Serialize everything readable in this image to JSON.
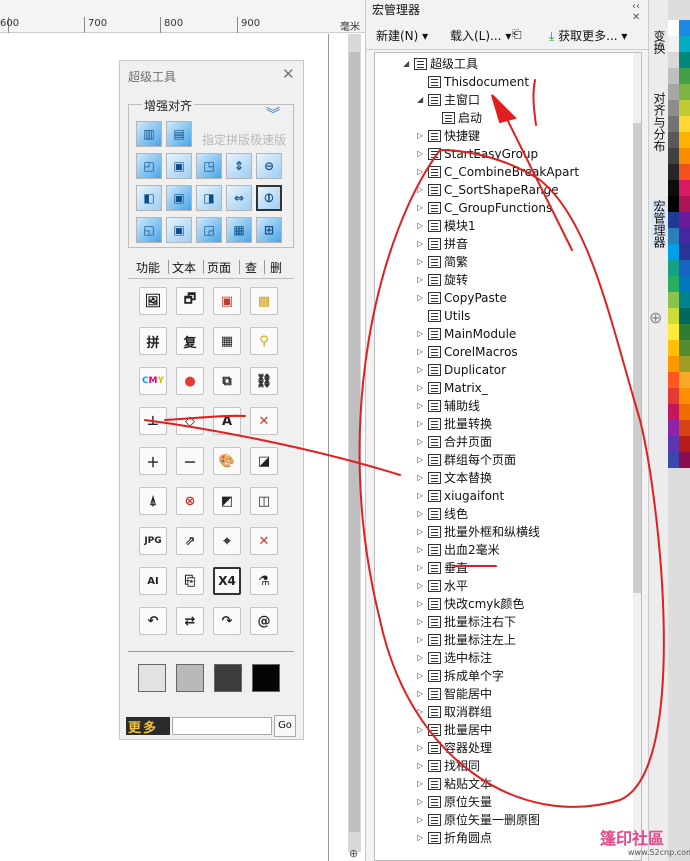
{
  "ruler": {
    "ticks": [
      "600",
      "700",
      "800",
      "900"
    ],
    "unit_label": "毫米"
  },
  "super_tool": {
    "title": "超级工具",
    "close": "✕",
    "align_group": "增强对齐",
    "fast_layout": "指定拼版极速版",
    "tabs": [
      "功能",
      "文本",
      "页面",
      "查",
      "删"
    ],
    "buttons": {
      "pin": "拼",
      "fu": "复",
      "x4": "X4"
    },
    "swatch_colors": [
      "#e2e2e2",
      "#b9b9b9",
      "#3c3c3c",
      "#050505"
    ],
    "more_label": "更多",
    "go_label": "Go"
  },
  "macro_manager": {
    "title": "宏管理器",
    "toolbar": {
      "new": "新建(N)",
      "load": "载入(L)...",
      "get_more": "获取更多..."
    },
    "tree": [
      {
        "label": "超级工具",
        "level": 0,
        "expander": "open"
      },
      {
        "label": "Thisdocument",
        "level": 1,
        "expander": "none"
      },
      {
        "label": "主窗口",
        "level": 1,
        "expander": "open"
      },
      {
        "label": "启动",
        "level": 2,
        "expander": "none"
      },
      {
        "label": "快捷键",
        "level": 1,
        "expander": "closed"
      },
      {
        "label": "StartEasyGroup",
        "level": 1,
        "expander": "closed"
      },
      {
        "label": "C_CombineBreakApart",
        "level": 1,
        "expander": "closed"
      },
      {
        "label": "C_SortShapeRange",
        "level": 1,
        "expander": "closed"
      },
      {
        "label": "C_GroupFunctions",
        "level": 1,
        "expander": "closed"
      },
      {
        "label": "模块1",
        "level": 1,
        "expander": "closed"
      },
      {
        "label": "拼音",
        "level": 1,
        "expander": "closed"
      },
      {
        "label": "简繁",
        "level": 1,
        "expander": "closed"
      },
      {
        "label": "旋转",
        "level": 1,
        "expander": "closed"
      },
      {
        "label": "CopyPaste",
        "level": 1,
        "expander": "closed"
      },
      {
        "label": "Utils",
        "level": 1,
        "expander": "none"
      },
      {
        "label": "MainModule",
        "level": 1,
        "expander": "closed"
      },
      {
        "label": "CorelMacros",
        "level": 1,
        "expander": "closed"
      },
      {
        "label": "Duplicator",
        "level": 1,
        "expander": "closed"
      },
      {
        "label": "Matrix_",
        "level": 1,
        "expander": "closed"
      },
      {
        "label": "辅助线",
        "level": 1,
        "expander": "closed"
      },
      {
        "label": "批量转换",
        "level": 1,
        "expander": "closed"
      },
      {
        "label": "合并页面",
        "level": 1,
        "expander": "closed"
      },
      {
        "label": "群组每个页面",
        "level": 1,
        "expander": "closed"
      },
      {
        "label": "文本替换",
        "level": 1,
        "expander": "closed"
      },
      {
        "label": "xiugaifont",
        "level": 1,
        "expander": "closed"
      },
      {
        "label": "线色",
        "level": 1,
        "expander": "closed"
      },
      {
        "label": "批量外框和纵横线",
        "level": 1,
        "expander": "closed"
      },
      {
        "label": "出血2毫米",
        "level": 1,
        "expander": "closed"
      },
      {
        "label": "垂直",
        "level": 1,
        "expander": "closed"
      },
      {
        "label": "水平",
        "level": 1,
        "expander": "closed"
      },
      {
        "label": "快改cmyk颜色",
        "level": 1,
        "expander": "closed"
      },
      {
        "label": "批量标注右下",
        "level": 1,
        "expander": "closed"
      },
      {
        "label": "批量标注左上",
        "level": 1,
        "expander": "closed"
      },
      {
        "label": "选中标注",
        "level": 1,
        "expander": "closed"
      },
      {
        "label": "拆成单个字",
        "level": 1,
        "expander": "closed"
      },
      {
        "label": "智能居中",
        "level": 1,
        "expander": "closed"
      },
      {
        "label": "取消群组",
        "level": 1,
        "expander": "closed"
      },
      {
        "label": "批量居中",
        "level": 1,
        "expander": "closed"
      },
      {
        "label": "容器处理",
        "level": 1,
        "expander": "closed"
      },
      {
        "label": "找相同",
        "level": 1,
        "expander": "closed"
      },
      {
        "label": "粘贴文本",
        "level": 1,
        "expander": "closed"
      },
      {
        "label": "原位矢量",
        "level": 1,
        "expander": "closed"
      },
      {
        "label": "原位矢量一删原图",
        "level": 1,
        "expander": "closed"
      },
      {
        "label": "折角圆点",
        "level": 1,
        "expander": "closed"
      }
    ]
  },
  "docker_tabs": [
    "变换",
    "对齐与分布",
    "宏管理器"
  ],
  "palette": {
    "colors": [
      "#ffffff",
      "#f2f2f2",
      "#d9d9d9",
      "#bfbfbf",
      "#a6a6a6",
      "#8c8c8c",
      "#737373",
      "#595959",
      "#404040",
      "#262626",
      "#0d0d0d",
      "#000000",
      "#1f3a93",
      "#2980b9",
      "#00a0e9",
      "#16a085",
      "#27ae60",
      "#8bc34a",
      "#cddc39",
      "#ffeb3b",
      "#ffc107",
      "#ff9800",
      "#ff5722",
      "#e53935",
      "#c2185b",
      "#8e24aa",
      "#5e35b1",
      "#3949ab",
      "#1e88e5",
      "#00acc1",
      "#00897b",
      "#43a047",
      "#7cb342",
      "#c0ca33",
      "#fdd835",
      "#ffb300",
      "#fb8c00",
      "#f4511e",
      "#d81b60",
      "#ad1457",
      "#6a1b9a",
      "#4527a0",
      "#283593",
      "#1565c0",
      "#0277bd",
      "#00838f",
      "#00695c",
      "#2e7d32",
      "#558b2f",
      "#9e9d24",
      "#f9a825",
      "#ff8f00",
      "#ef6c00",
      "#d84315",
      "#b71c1c",
      "#880e4f"
    ]
  },
  "watermark": {
    "text": "篷印社區",
    "url": "www.52cnp.com"
  }
}
